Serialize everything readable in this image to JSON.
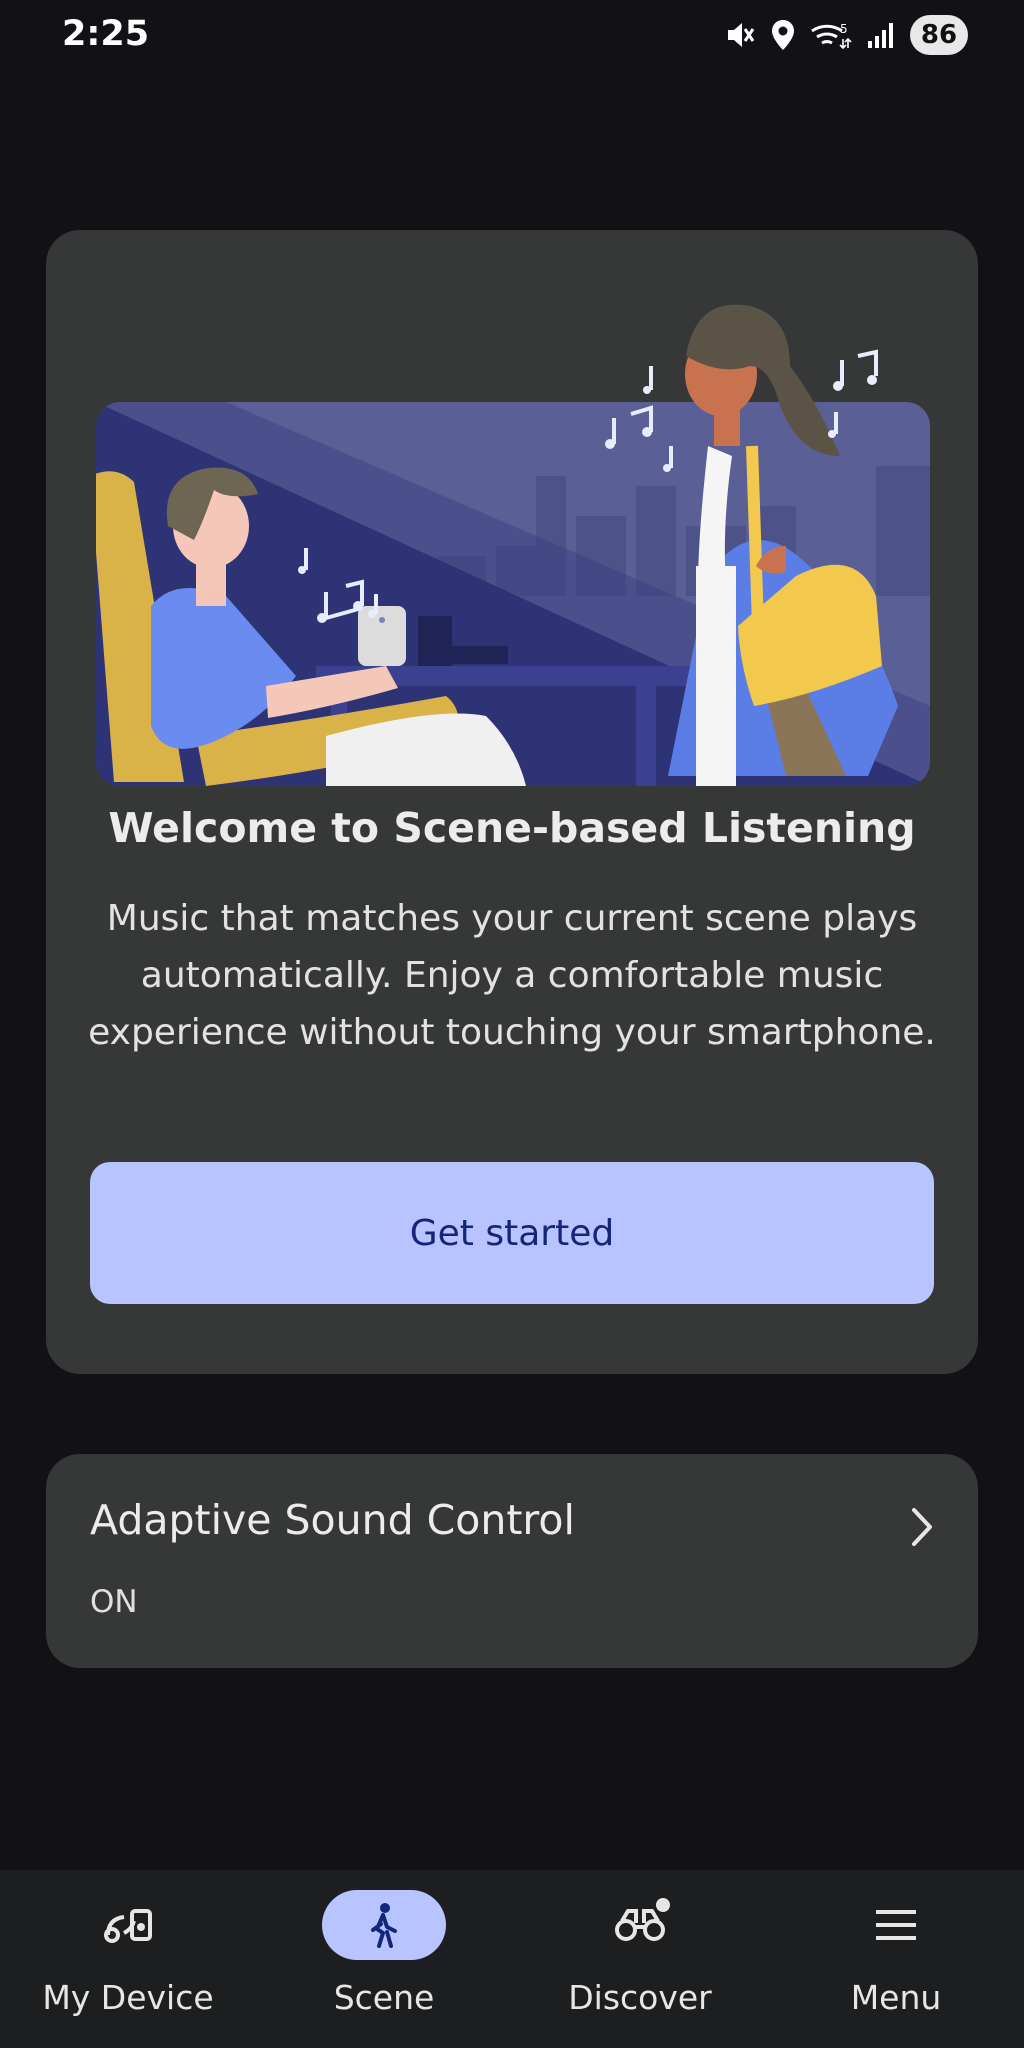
{
  "status_bar": {
    "time": "2:25",
    "battery": "86",
    "icons": [
      "mute-icon",
      "location-icon",
      "wifi-icon",
      "signal-icon"
    ]
  },
  "welcome_card": {
    "title": "Welcome to Scene-based Listening",
    "description": "Music that matches your current scene plays automatically. Enjoy a comfortable music experience without touching your smartphone.",
    "button_label": "Get started"
  },
  "adaptive_sound": {
    "title": "Adaptive Sound Control",
    "status": "ON"
  },
  "bottom_nav": {
    "items": [
      {
        "label": "My Device",
        "icon": "device-icon",
        "active": false
      },
      {
        "label": "Scene",
        "icon": "walking-person-icon",
        "active": true
      },
      {
        "label": "Discover",
        "icon": "binoculars-icon",
        "active": false,
        "badge": true
      },
      {
        "label": "Menu",
        "icon": "menu-icon",
        "active": false
      }
    ]
  },
  "colors": {
    "background": "#121216",
    "card": "#363838",
    "accent": "#b8c4ff",
    "accent_text": "#13267a",
    "nav_background": "#1c1e1f"
  }
}
